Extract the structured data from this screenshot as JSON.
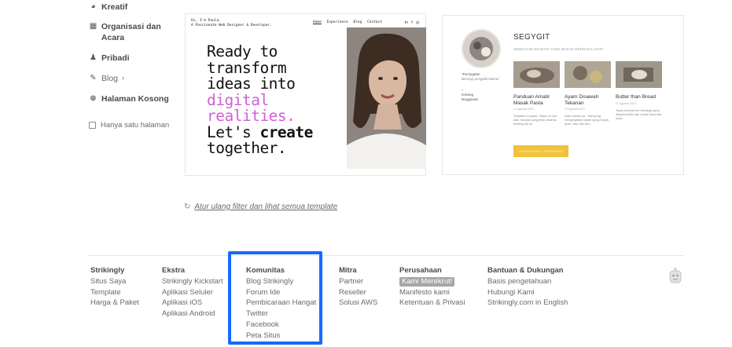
{
  "sidebar": {
    "items": [
      {
        "label": "Kreatif",
        "icon": "palette-icon"
      },
      {
        "label": "Organisasi dan Acara",
        "icon": "calendar-icon"
      },
      {
        "label": "Pribadi",
        "icon": "person-icon"
      },
      {
        "label": "Blog",
        "icon": "pen-icon"
      },
      {
        "label": "Halaman Kosong",
        "icon": "plus-circle-icon"
      }
    ],
    "single_page_label": "Hanya satu halaman"
  },
  "templates": {
    "paula": {
      "header_line1": "Hi, I'm Paula.",
      "header_line2": "A Passionate Web Designer & Developer.",
      "nav": [
        "Home",
        "Experience",
        "Blog",
        "Contact"
      ],
      "social": [
        "in",
        "f",
        "◎"
      ],
      "hero_line1": "Ready to",
      "hero_line2": "transform",
      "hero_line3": "ideas into",
      "hero_line4": "digital",
      "hero_line5": "realities.",
      "hero_line6a": "Let's",
      "hero_line6b": "create",
      "hero_line7": "together."
    },
    "segygit": {
      "title": "SEGYGIT",
      "subtitle": "SEBUAH BLOG BAGI YANG MASAK DENGAN LAHAP",
      "left_label": "*Peringatan",
      "left_sub": "Bersiap pengeliti kulinel",
      "left_tag1": "tentang",
      "left_tag2": "langganan",
      "posts": [
        {
          "title": "Panduan Amatir Masak Pasta",
          "meta": "21 Agustus 2021",
          "body": "Tindakan tu pasta · Basa, Ini dan daki. Banyak yang telah dibahas tentang hal ini."
        },
        {
          "title": "Ayam Disawah Tekanan",
          "meta": "22 Agustus 2021",
          "body": "Iolah rakaan pa · Nampung mengingatkan ayam yang empuk, jarak, atau lain-lain..."
        },
        {
          "title": "Butter than Bread",
          "meta": "27 Agustus 2021",
          "body": "Tepat terkenal ber mentega yang dilapisi ketela dan rumah lama kita suka..."
        }
      ],
      "button_label": "LANGGANAN SEKARANG"
    }
  },
  "reset_link": "Atur ulang filter dan lihat semua template",
  "footer": {
    "columns": [
      {
        "heading": "Strikingly",
        "links": [
          "Situs Saya",
          "Template",
          "Harga & Paket"
        ]
      },
      {
        "heading": "Ekstra",
        "links": [
          "Strikingly Kickstart",
          "Aplikasi Seluler",
          "Aplikasi iOS",
          "Aplikasi Android"
        ]
      },
      {
        "heading": "Komunitas",
        "links": [
          "Blog Strikingly",
          "Forum Ide",
          "Pembicaraan Hangat",
          "Twitter",
          "Facebook",
          "Peta Situs"
        ]
      },
      {
        "heading": "Mitra",
        "links": [
          "Partner",
          "Reseller",
          "Solusi AWS"
        ]
      },
      {
        "heading": "Perusahaan",
        "badge": "Kami Merekrut!",
        "links": [
          "Manifesto kami",
          "Ketentuan & Privasi"
        ]
      },
      {
        "heading": "Bantuan & Dukungan",
        "links": [
          "Basis pengetahuan",
          "Hubungi Kami",
          "Strikingly.com in English"
        ]
      }
    ]
  },
  "colors": {
    "highlight": "#1769ff",
    "pink_text": "#d35fd8",
    "button_yellow": "#f2c23a"
  }
}
